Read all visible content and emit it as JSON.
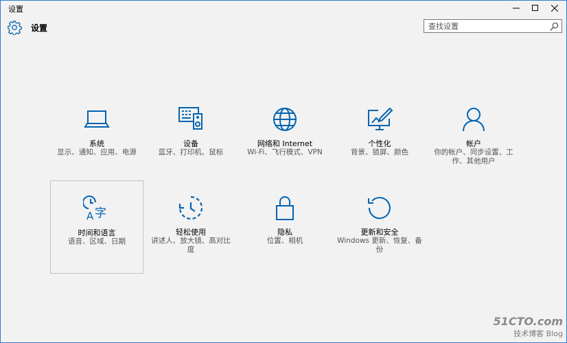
{
  "window": {
    "title": "设置"
  },
  "header": {
    "title": "设置",
    "icon": "gear-icon"
  },
  "search": {
    "placeholder": "查找设置",
    "value": ""
  },
  "tiles": [
    {
      "name": "系统",
      "desc": "显示、通知、应用、电源",
      "icon": "laptop-icon"
    },
    {
      "name": "设备",
      "desc": "蓝牙、打印机、鼠标",
      "icon": "devices-icon"
    },
    {
      "name": "网络和 Internet",
      "desc": "Wi-Fi、飞行模式、VPN",
      "icon": "globe-icon"
    },
    {
      "name": "个性化",
      "desc": "背景、锁屏、颜色",
      "icon": "personalization-icon"
    },
    {
      "name": "帐户",
      "desc": "你的帐户、同步设置、工作、其他用户",
      "icon": "person-icon"
    },
    {
      "name": "时间和语言",
      "desc": "语音、区域、日期",
      "icon": "time-language-icon"
    },
    {
      "name": "轻松使用",
      "desc": "讲述人、放大镜、高对比度",
      "icon": "ease-of-access-icon"
    },
    {
      "name": "隐私",
      "desc": "位置、相机",
      "icon": "lock-icon"
    },
    {
      "name": "更新和安全",
      "desc": "Windows 更新、恢复、备份",
      "icon": "update-icon"
    }
  ],
  "watermark": {
    "line1": "51CTO.com",
    "line2": "技术博客 Blog"
  },
  "colors": {
    "accent": "#0063b1",
    "background": "#f2f2f2",
    "border": "#2b7bd6"
  }
}
